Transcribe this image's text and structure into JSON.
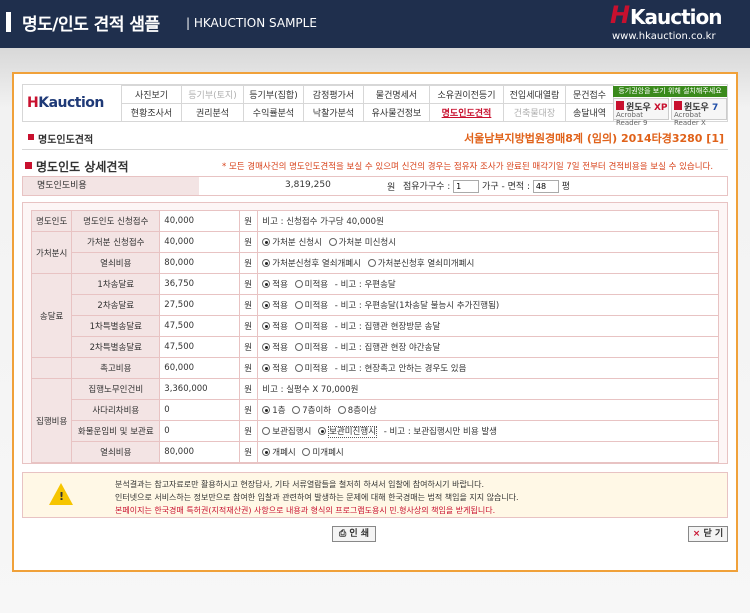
{
  "header": {
    "title": "명도/인도 견적 샘플",
    "subtitle": "| HKAUCTION SAMPLE",
    "logo_h": "H",
    "logo_rest": "Kauction",
    "logo_url": "www.hkauction.co.kr"
  },
  "nav": {
    "logo_h": "H",
    "logo_rest": "Kauction",
    "row1": [
      "사진보기",
      "등기부(토지)",
      "등기부(집합)",
      "감정평가서",
      "물건명세서",
      "소유권이전등기",
      "전입세대열람",
      "문건접수"
    ],
    "row2": [
      "현황조사서",
      "권리분석",
      "수익률분석",
      "낙찰가분석",
      "유사물건정보",
      "명도인도견적",
      "건축물대장",
      "송달내역"
    ],
    "download_note": "등기권앙을 보기 위해 설치해주세요",
    "btn_xp": {
      "label": "윈도우",
      "ver": "XP",
      "sub": "Acrobat Reader 9"
    },
    "btn_7": {
      "label": "윈도우",
      "ver": "7",
      "sub": "Acrobat Reader X"
    }
  },
  "page": {
    "section_label": "명도인도견적",
    "case_info": "서울남부지방법원경매8계  (임의) 2014타경3280 [1]",
    "detail_title": "명도인도 상세견적",
    "detail_note": "* 모든 경매사건의 명도인도견적을 보실 수 있으며 신건의 경우는 점유자 조사가 완료된 매각기일 7일 전부터 견적비용을 보실 수 있습니다."
  },
  "summary": {
    "label": "명도인도비용",
    "amount": "3,819,250",
    "won": "원",
    "occupants_label": "점유가구수 :",
    "occupants_value": "1",
    "area_label": "가구 - 면적 :",
    "area_value": "48",
    "area_unit": "평"
  },
  "rows": {
    "group_myeongdo": "명도인도",
    "group_gacheobun": "가처분시",
    "group_songdal": "송달료",
    "group_jiphaeng": "집행비용",
    "won": "원",
    "r1": {
      "label": "명도인도 신청접수",
      "amount": "40,000",
      "desc": "비고 : 신청접수 가구당 40,000원"
    },
    "r2": {
      "label": "가처분 신청접수",
      "amount": "40,000",
      "opt1": "가처분 신청시",
      "opt2": "가처분 미신청시"
    },
    "r3": {
      "label": "열쇠비용",
      "amount": "80,000",
      "opt1": "가처분신청후 열쇠개폐시",
      "opt2": "가처분신청후 열쇠미개폐시"
    },
    "r4": {
      "label": "1차송달료",
      "amount": "36,750",
      "opt1": "적용",
      "opt2": "미적용",
      "desc": "- 비고 : 우편송달"
    },
    "r5": {
      "label": "2차송달료",
      "amount": "27,500",
      "opt1": "적용",
      "opt2": "미적용",
      "desc": "- 비고 : 우편송달(1차송달 불능시 추가진행됨)"
    },
    "r6": {
      "label": "1차특별송달료",
      "amount": "47,500",
      "opt1": "적용",
      "opt2": "미적용",
      "desc": "- 비고 : 집행관 현장방문 송달"
    },
    "r7": {
      "label": "2차특별송달료",
      "amount": "47,500",
      "opt1": "적용",
      "opt2": "미적용",
      "desc": "- 비고 : 집행관 현장 야간송달"
    },
    "r8": {
      "label": "촉고비용",
      "amount": "60,000",
      "opt1": "적용",
      "opt2": "미적용",
      "desc": "- 비고 : 현장촉고 안하는 경우도 있음"
    },
    "r9": {
      "label": "집행노무인건비",
      "amount": "3,360,000",
      "desc": "비고 : 실평수 X 70,000원"
    },
    "r10": {
      "label": "사다리차비용",
      "amount": "0",
      "opt1": "1층",
      "opt2": "7층이하",
      "opt3": "8층이상"
    },
    "r11": {
      "label": "화물운임비 및 보관료",
      "amount": "0",
      "opt1": "보관집행시",
      "opt2": "보관미진행시",
      "desc": "- 비고 : 보관집행시만 비용 발생"
    },
    "r12": {
      "label": "열쇠비용",
      "amount": "80,000",
      "opt1": "개폐시",
      "opt2": "미개폐시"
    }
  },
  "notice": {
    "line1": "분석결과는 참고자료로만 활용하시고 현장답사, 기타 서류열람들을 철저히 하셔서 입찰에 참여하시기 바랍니다.",
    "line2": "인터넷으로 서비스하는 정보만으로 참여한 입찰과 관련하여 발생하는 문제에 대해 한국경매는 법적 책임을 지지 않습니다.",
    "line3": "본페이지는 한국경매 특허권(지적재산권) 사항으로 내용과 형식의 프로그램도용시 민.형사상의 책임을 받게됩니다."
  },
  "buttons": {
    "print": "인 쇄",
    "close": "닫 기"
  }
}
